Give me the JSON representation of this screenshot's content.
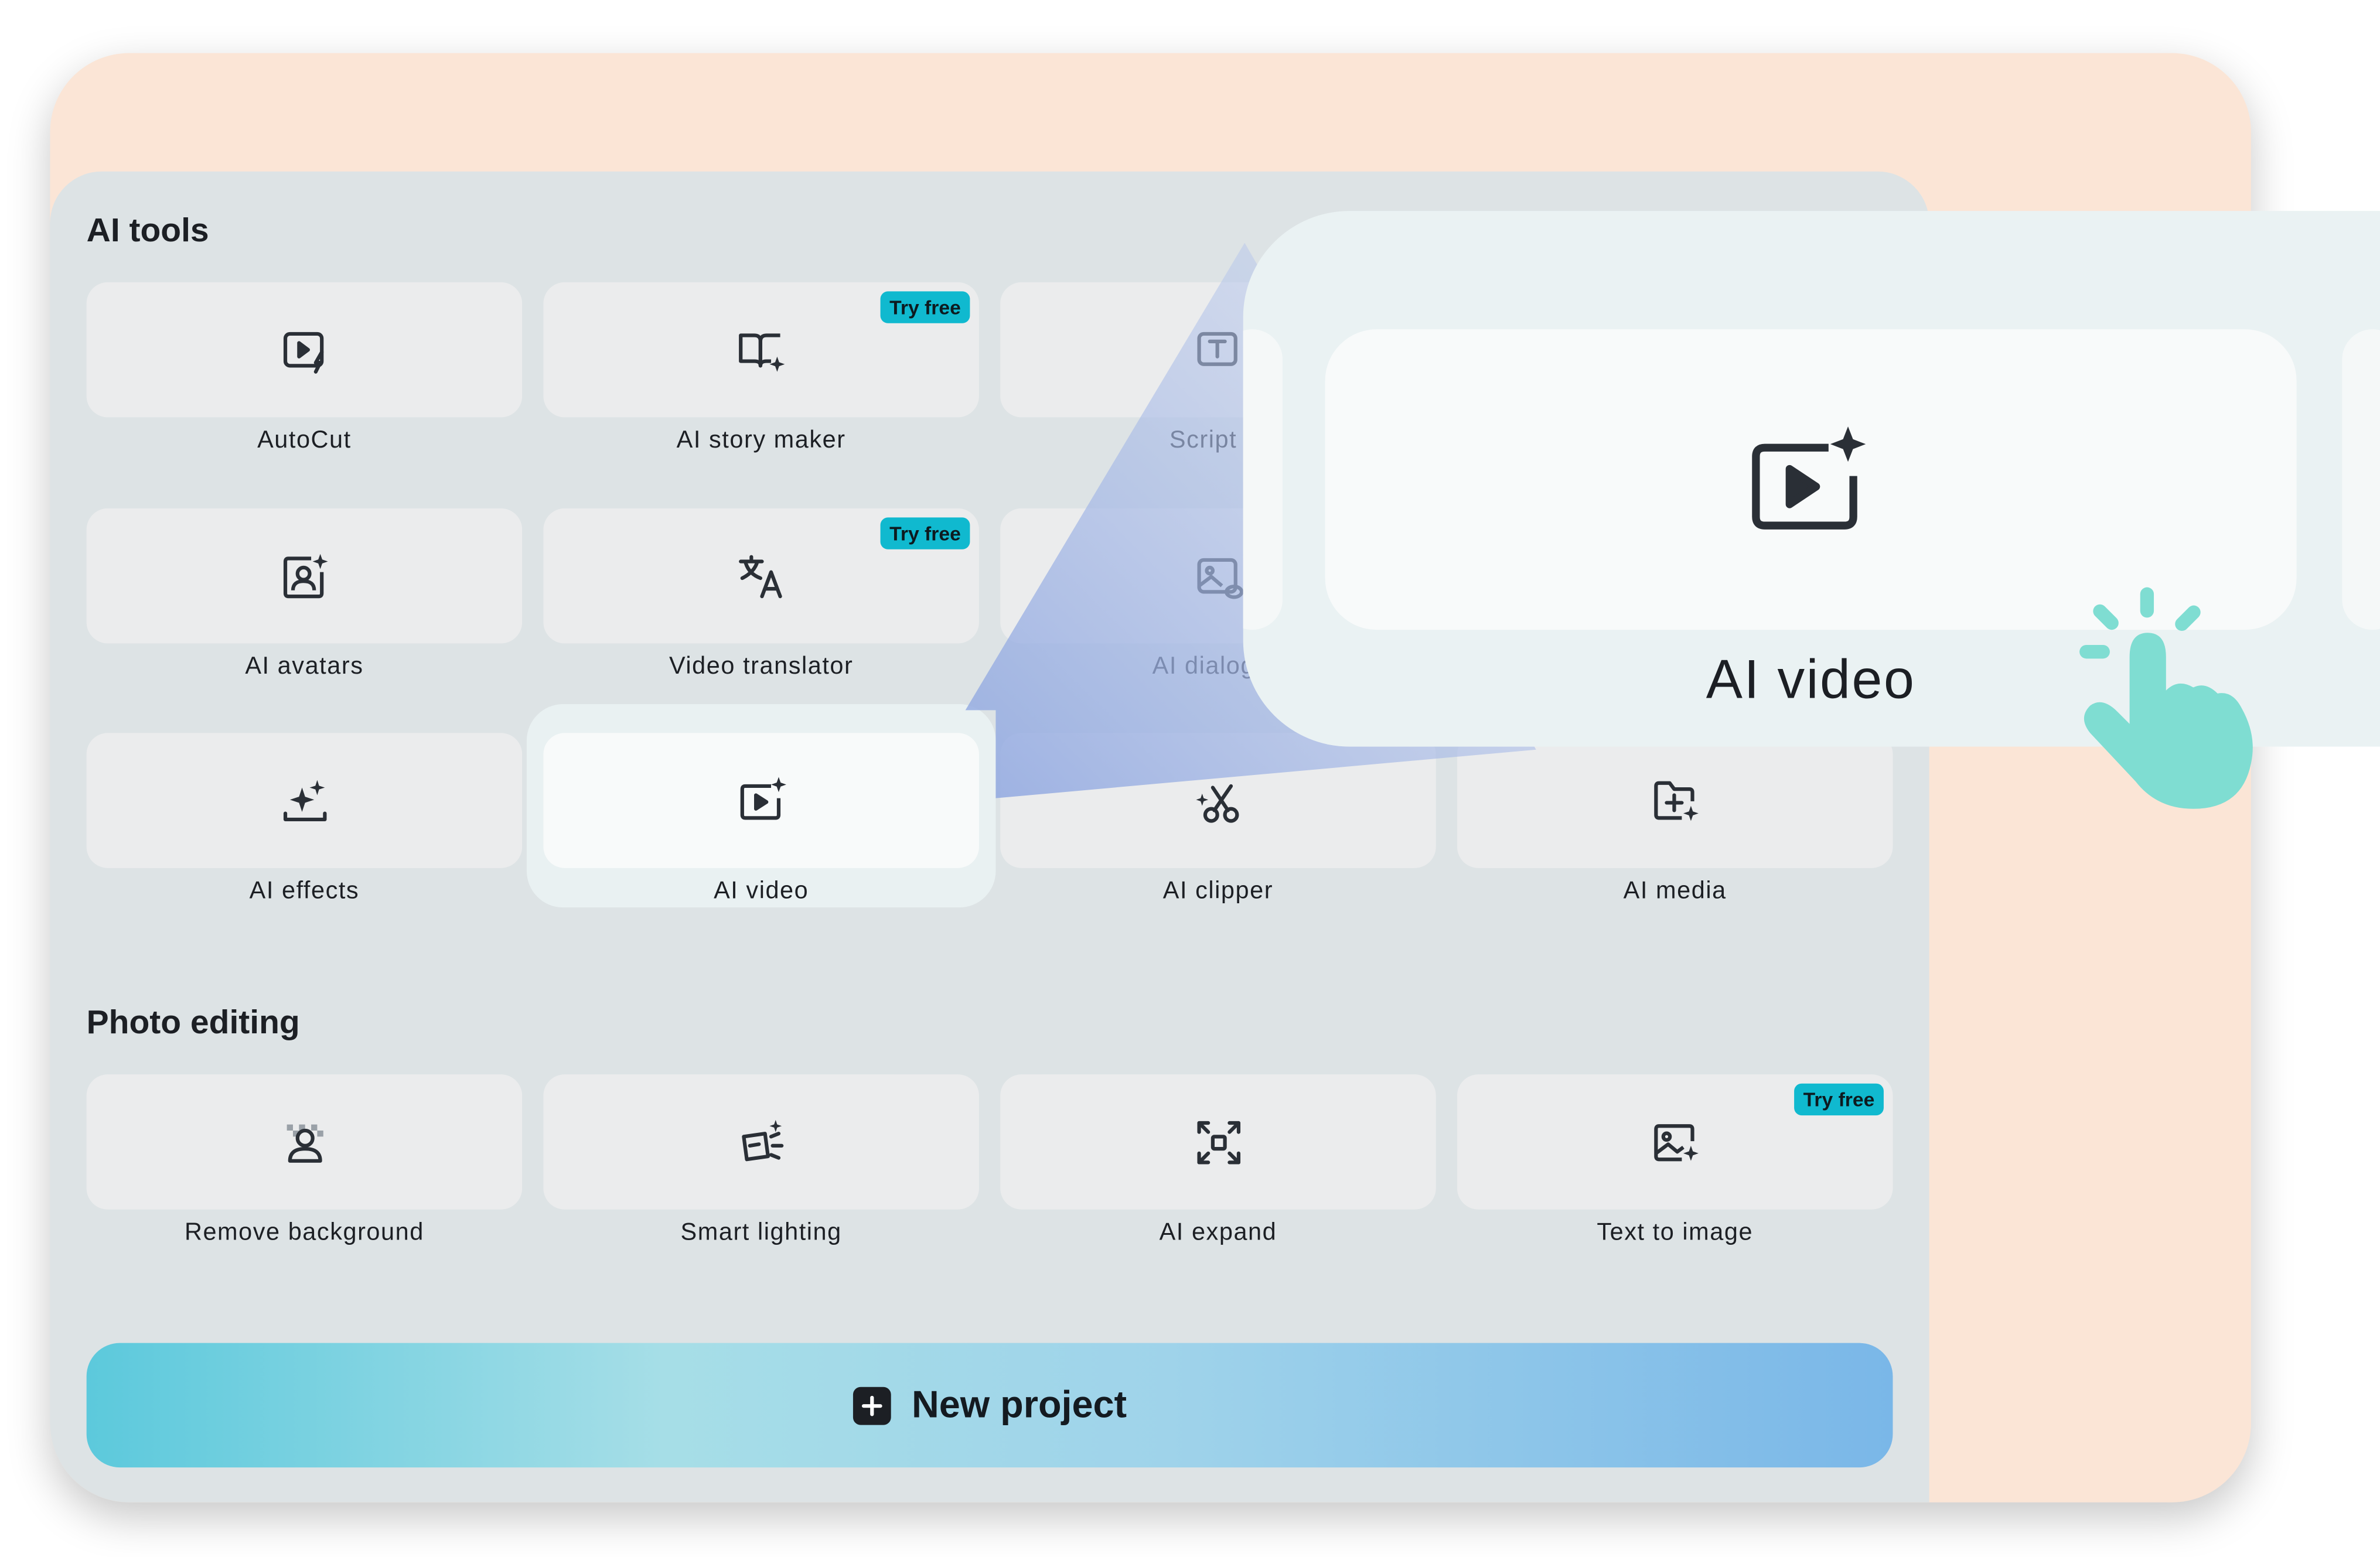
{
  "sections": {
    "ai_tools_title": "AI tools",
    "photo_editing_title": "Photo editing"
  },
  "ai_tools": [
    {
      "label": "AutoCut",
      "icon": "autocut-icon"
    },
    {
      "label": "AI story maker",
      "icon": "book-sparkle-icon",
      "badge": "Try free"
    },
    {
      "label": "Script to",
      "icon": "text-box-icon"
    },
    {
      "label": "AI avatars",
      "icon": "avatar-icon"
    },
    {
      "label": "Video translator",
      "icon": "translate-icon",
      "badge": "Try free"
    },
    {
      "label": "AI dialogue",
      "icon": "image-chat-icon"
    },
    {
      "label": "AI effects",
      "icon": "sparkles-icon"
    },
    {
      "label": "AI video",
      "icon": "video-sparkle-icon"
    },
    {
      "label": "AI clipper",
      "icon": "scissors-icon"
    },
    {
      "label": "AI media",
      "icon": "folder-sparkle-icon"
    }
  ],
  "photo_editing": [
    {
      "label": "Remove background",
      "icon": "remove-bg-icon"
    },
    {
      "label": "Smart lighting",
      "icon": "lighting-icon"
    },
    {
      "label": "AI expand",
      "icon": "expand-icon"
    },
    {
      "label": "Text to image",
      "icon": "image-sparkle-icon",
      "badge": "Try free"
    }
  ],
  "zoom": {
    "label": "AI video",
    "icon": "video-sparkle-icon"
  },
  "new_project": {
    "label": "New project",
    "icon": "plus-icon"
  },
  "colors": {
    "accent_badge": "#10b9cf",
    "peach": "#fbe5d6",
    "hand": "#7fddd2"
  }
}
